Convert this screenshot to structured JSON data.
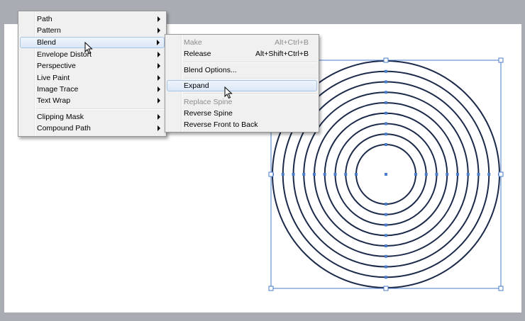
{
  "main_menu": {
    "items": [
      {
        "label": "Path",
        "submenu": true
      },
      {
        "label": "Pattern",
        "submenu": true
      },
      {
        "label": "Blend",
        "submenu": true,
        "highlighted": true
      },
      {
        "label": "Envelope Distort",
        "submenu": true
      },
      {
        "label": "Perspective",
        "submenu": true
      },
      {
        "label": "Live Paint",
        "submenu": true
      },
      {
        "label": "Image Trace",
        "submenu": true
      },
      {
        "label": "Text Wrap",
        "submenu": true
      },
      {
        "label": "Clipping Mask",
        "submenu": true
      },
      {
        "label": "Compound Path",
        "submenu": true
      }
    ]
  },
  "blend_submenu": {
    "items": [
      {
        "label": "Make",
        "shortcut": "Alt+Ctrl+B",
        "enabled": false
      },
      {
        "label": "Release",
        "shortcut": "Alt+Shift+Ctrl+B",
        "enabled": true
      },
      {
        "label": "Blend Options...",
        "enabled": true
      },
      {
        "label": "Expand",
        "enabled": true,
        "highlighted": true
      },
      {
        "label": "Replace Spine",
        "enabled": false
      },
      {
        "label": "Reverse Spine",
        "enabled": true
      },
      {
        "label": "Reverse Front to Back",
        "enabled": true
      }
    ]
  },
  "canvas": {
    "ring_count": 9,
    "stroke_color": "#1c2a4a",
    "selection_color": "#4a7bc8"
  },
  "colors": {
    "workspace_bg": "#a9adb3",
    "artboard_bg": "#ffffff",
    "menu_highlight": "#dbe8f7"
  }
}
